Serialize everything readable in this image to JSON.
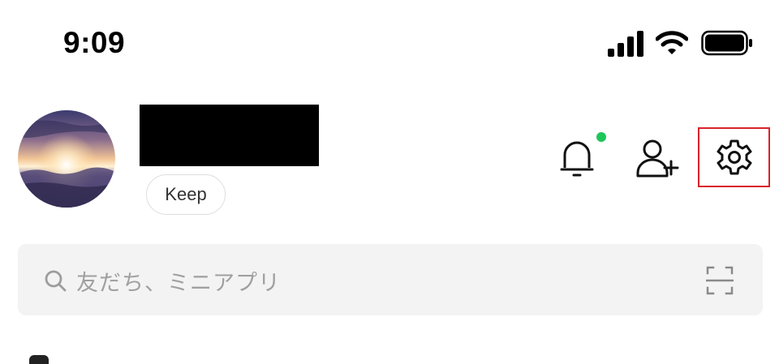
{
  "status_bar": {
    "time": "9:09",
    "icons": [
      "cellular-signal-icon",
      "wifi-icon",
      "battery-icon"
    ]
  },
  "profile": {
    "avatar_icon": "avatar-sunset-photo",
    "name_redacted": true,
    "keep_label": "Keep"
  },
  "header_actions": {
    "icons": [
      "bell-icon",
      "add-friend-icon",
      "gear-icon"
    ],
    "notification_dot_color": "#1dc75a",
    "highlight_color": "#d8232a",
    "highlighted": "gear-icon"
  },
  "search": {
    "placeholder": "友だち、ミニアプリ",
    "value": "",
    "left_icon": "search-icon",
    "right_icon": "qr-scan-icon"
  }
}
